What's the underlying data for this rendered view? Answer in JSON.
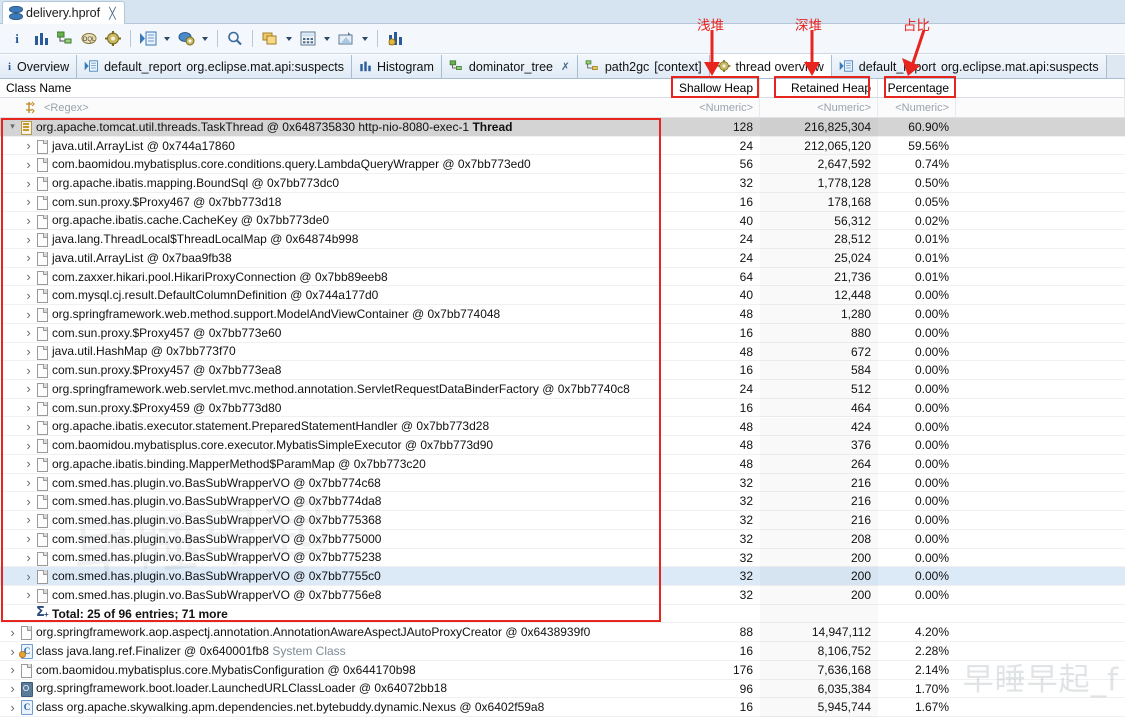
{
  "window": {
    "editor_tab": {
      "label": "delivery.hprof",
      "close": "╳",
      "icon": "heap-dump-icon"
    }
  },
  "toolbar": {
    "buttons": [
      {
        "name": "overview-info",
        "icon": "info-icon",
        "glyph": "i"
      },
      {
        "name": "histogram",
        "icon": "histogram-icon",
        "glyph": "bars"
      },
      {
        "name": "dominator-tree",
        "icon": "tree-icon",
        "glyph": "tree"
      },
      {
        "name": "oql",
        "icon": "oql-icon",
        "glyph": "OQL"
      },
      {
        "name": "run-expert-system",
        "icon": "gears-icon",
        "glyph": "gears"
      },
      {
        "name": "open-query-browser",
        "icon": "query-browser-icon",
        "glyph": "query"
      },
      {
        "name": "run-report",
        "icon": "report-gear-icon",
        "glyph": "report"
      },
      {
        "name": "find-objects",
        "icon": "search-icon",
        "glyph": "magnifier"
      },
      {
        "name": "group-by",
        "icon": "group-folders-icon",
        "glyph": "folders"
      },
      {
        "name": "calculator",
        "icon": "calculator-icon",
        "glyph": "calc"
      },
      {
        "name": "export",
        "icon": "export-icon",
        "glyph": "export"
      },
      {
        "name": "compare",
        "icon": "compare-bars-icon",
        "glyph": "compare"
      }
    ]
  },
  "view_tabs": [
    {
      "label": "Overview",
      "icon": "info-icon",
      "active": false,
      "closable": false
    },
    {
      "label": "default_report",
      "sub": "org.eclipse.mat.api:suspects",
      "icon": "report-icon",
      "active": false,
      "closable": false
    },
    {
      "label": "Histogram",
      "icon": "histogram-icon",
      "active": false,
      "closable": false
    },
    {
      "label": "dominator_tree",
      "icon": "tree-icon",
      "active": false,
      "closable": true
    },
    {
      "label": "path2gc",
      "sub": "[context]",
      "icon": "path-icon",
      "active": false,
      "closable": false
    },
    {
      "label": "thread overview",
      "icon": "gears-icon",
      "active": true,
      "closable": false
    },
    {
      "label": "default_report",
      "sub": "org.eclipse.mat.api:suspects",
      "icon": "report-icon",
      "active": false,
      "closable": false
    }
  ],
  "columns": {
    "class_name": "Class Name",
    "shallow_heap": "Shallow Heap",
    "retained_heap": "Retained Heap",
    "percentage": "Percentage"
  },
  "filter_row": {
    "class_name": "<Regex>",
    "shallow_heap": "<Numeric>",
    "retained_heap": "<Numeric>",
    "percentage": "<Numeric>"
  },
  "annotations": [
    {
      "label": "浅堆",
      "target": "Shallow Heap",
      "color": "#e8241f"
    },
    {
      "label": "深堆",
      "target": "Retained Heap",
      "color": "#e8241f"
    },
    {
      "label": "占比",
      "target": "Percentage",
      "color": "#e8241f"
    }
  ],
  "watermark": {
    "bottom_right": "早睡早起_f",
    "center": "早睡早起"
  },
  "rows": [
    {
      "depth": 0,
      "twisty": "open",
      "icon": "thread",
      "name": "org.apache.tomcat.util.threads.TaskThread @ 0x648735830  http-nio-8080-exec-1 ",
      "bold": "Thread",
      "shallow": "128",
      "retained": "216,825,304",
      "pct": "60.90%",
      "state": "sel"
    },
    {
      "depth": 1,
      "twisty": "closed",
      "icon": "obj",
      "name": "java.util.ArrayList @ 0x744a17860",
      "shallow": "24",
      "retained": "212,065,120",
      "pct": "59.56%",
      "state": ""
    },
    {
      "depth": 1,
      "twisty": "closed",
      "icon": "obj",
      "name": "com.baomidou.mybatisplus.core.conditions.query.LambdaQueryWrapper @ 0x7bb773ed0",
      "shallow": "56",
      "retained": "2,647,592",
      "pct": "0.74%",
      "state": ""
    },
    {
      "depth": 1,
      "twisty": "closed",
      "icon": "obj",
      "name": "org.apache.ibatis.mapping.BoundSql @ 0x7bb773dc0",
      "shallow": "32",
      "retained": "1,778,128",
      "pct": "0.50%",
      "state": ""
    },
    {
      "depth": 1,
      "twisty": "closed",
      "icon": "obj",
      "name": "com.sun.proxy.$Proxy467 @ 0x7bb773d18",
      "shallow": "16",
      "retained": "178,168",
      "pct": "0.05%",
      "state": ""
    },
    {
      "depth": 1,
      "twisty": "closed",
      "icon": "obj",
      "name": "org.apache.ibatis.cache.CacheKey @ 0x7bb773de0",
      "shallow": "40",
      "retained": "56,312",
      "pct": "0.02%",
      "state": ""
    },
    {
      "depth": 1,
      "twisty": "closed",
      "icon": "obj",
      "name": "java.lang.ThreadLocal$ThreadLocalMap @ 0x64874b998",
      "shallow": "24",
      "retained": "28,512",
      "pct": "0.01%",
      "state": ""
    },
    {
      "depth": 1,
      "twisty": "closed",
      "icon": "obj",
      "name": "java.util.ArrayList @ 0x7baa9fb38",
      "shallow": "24",
      "retained": "25,024",
      "pct": "0.01%",
      "state": ""
    },
    {
      "depth": 1,
      "twisty": "closed",
      "icon": "obj",
      "name": "com.zaxxer.hikari.pool.HikariProxyConnection @ 0x7bb89eeb8",
      "shallow": "64",
      "retained": "21,736",
      "pct": "0.01%",
      "state": ""
    },
    {
      "depth": 1,
      "twisty": "closed",
      "icon": "obj",
      "name": "com.mysql.cj.result.DefaultColumnDefinition @ 0x744a177d0",
      "shallow": "40",
      "retained": "12,448",
      "pct": "0.00%",
      "state": ""
    },
    {
      "depth": 1,
      "twisty": "closed",
      "icon": "obj",
      "name": "org.springframework.web.method.support.ModelAndViewContainer @ 0x7bb774048",
      "shallow": "48",
      "retained": "1,280",
      "pct": "0.00%",
      "state": ""
    },
    {
      "depth": 1,
      "twisty": "closed",
      "icon": "obj",
      "name": "com.sun.proxy.$Proxy457 @ 0x7bb773e60",
      "shallow": "16",
      "retained": "880",
      "pct": "0.00%",
      "state": ""
    },
    {
      "depth": 1,
      "twisty": "closed",
      "icon": "obj",
      "name": "java.util.HashMap @ 0x7bb773f70",
      "shallow": "48",
      "retained": "672",
      "pct": "0.00%",
      "state": ""
    },
    {
      "depth": 1,
      "twisty": "closed",
      "icon": "obj",
      "name": "com.sun.proxy.$Proxy457 @ 0x7bb773ea8",
      "shallow": "16",
      "retained": "584",
      "pct": "0.00%",
      "state": ""
    },
    {
      "depth": 1,
      "twisty": "closed",
      "icon": "obj",
      "name": "org.springframework.web.servlet.mvc.method.annotation.ServletRequestDataBinderFactory @ 0x7bb7740c8",
      "shallow": "24",
      "retained": "512",
      "pct": "0.00%",
      "state": ""
    },
    {
      "depth": 1,
      "twisty": "closed",
      "icon": "obj",
      "name": "com.sun.proxy.$Proxy459 @ 0x7bb773d80",
      "shallow": "16",
      "retained": "464",
      "pct": "0.00%",
      "state": ""
    },
    {
      "depth": 1,
      "twisty": "closed",
      "icon": "obj",
      "name": "org.apache.ibatis.executor.statement.PreparedStatementHandler @ 0x7bb773d28",
      "shallow": "48",
      "retained": "424",
      "pct": "0.00%",
      "state": ""
    },
    {
      "depth": 1,
      "twisty": "closed",
      "icon": "obj",
      "name": "com.baomidou.mybatisplus.core.executor.MybatisSimpleExecutor @ 0x7bb773d90",
      "shallow": "48",
      "retained": "376",
      "pct": "0.00%",
      "state": ""
    },
    {
      "depth": 1,
      "twisty": "closed",
      "icon": "obj",
      "name": "org.apache.ibatis.binding.MapperMethod$ParamMap @ 0x7bb773c20",
      "shallow": "48",
      "retained": "264",
      "pct": "0.00%",
      "state": ""
    },
    {
      "depth": 1,
      "twisty": "closed",
      "icon": "obj",
      "name": "com.smed.has.plugin.vo.BasSubWrapperVO @ 0x7bb774c68",
      "shallow": "32",
      "retained": "216",
      "pct": "0.00%",
      "state": ""
    },
    {
      "depth": 1,
      "twisty": "closed",
      "icon": "obj",
      "name": "com.smed.has.plugin.vo.BasSubWrapperVO @ 0x7bb774da8",
      "shallow": "32",
      "retained": "216",
      "pct": "0.00%",
      "state": ""
    },
    {
      "depth": 1,
      "twisty": "closed",
      "icon": "obj",
      "name": "com.smed.has.plugin.vo.BasSubWrapperVO @ 0x7bb775368",
      "shallow": "32",
      "retained": "216",
      "pct": "0.00%",
      "state": ""
    },
    {
      "depth": 1,
      "twisty": "closed",
      "icon": "obj",
      "name": "com.smed.has.plugin.vo.BasSubWrapperVO @ 0x7bb775000",
      "shallow": "32",
      "retained": "208",
      "pct": "0.00%",
      "state": ""
    },
    {
      "depth": 1,
      "twisty": "closed",
      "icon": "obj",
      "name": "com.smed.has.plugin.vo.BasSubWrapperVO @ 0x7bb775238",
      "shallow": "32",
      "retained": "200",
      "pct": "0.00%",
      "state": ""
    },
    {
      "depth": 1,
      "twisty": "closed",
      "icon": "obj",
      "name": "com.smed.has.plugin.vo.BasSubWrapperVO @ 0x7bb7755c0",
      "shallow": "32",
      "retained": "200",
      "pct": "0.00%",
      "state": "hl"
    },
    {
      "depth": 1,
      "twisty": "closed",
      "icon": "obj",
      "name": "com.smed.has.plugin.vo.BasSubWrapperVO @ 0x7bb7756e8",
      "shallow": "32",
      "retained": "200",
      "pct": "0.00%",
      "state": ""
    },
    {
      "depth": 1,
      "twisty": "none",
      "icon": "sigma",
      "name": "",
      "bold": "Total: 25 of 96 entries; 71 more",
      "shallow": "",
      "retained": "",
      "pct": "",
      "state": "total"
    },
    {
      "depth": 0,
      "twisty": "closed",
      "icon": "obj",
      "name": "org.springframework.aop.aspectj.annotation.AnnotationAwareAspectJAutoProxyCreator @ 0x6438939f0",
      "shallow": "88",
      "retained": "14,947,112",
      "pct": "4.20%",
      "state": ""
    },
    {
      "depth": 0,
      "twisty": "closed",
      "icon": "class-sys",
      "name": "class java.lang.ref.Finalizer @ 0x640001fb8 ",
      "grey": "System Class",
      "shallow": "16",
      "retained": "8,106,752",
      "pct": "2.28%",
      "state": ""
    },
    {
      "depth": 0,
      "twisty": "closed",
      "icon": "obj",
      "name": "com.baomidou.mybatisplus.core.MybatisConfiguration @ 0x644170b98",
      "shallow": "176",
      "retained": "7,636,168",
      "pct": "2.14%",
      "state": ""
    },
    {
      "depth": 0,
      "twisty": "closed",
      "icon": "loader",
      "name": "org.springframework.boot.loader.LaunchedURLClassLoader @ 0x64072bb18",
      "shallow": "96",
      "retained": "6,035,384",
      "pct": "1.70%",
      "state": ""
    },
    {
      "depth": 0,
      "twisty": "closed",
      "icon": "class",
      "name": "class org.apache.skywalking.apm.dependencies.net.bytebuddy.dynamic.Nexus @ 0x6402f59a8",
      "shallow": "16",
      "retained": "5,945,744",
      "pct": "1.67%",
      "state": ""
    }
  ]
}
